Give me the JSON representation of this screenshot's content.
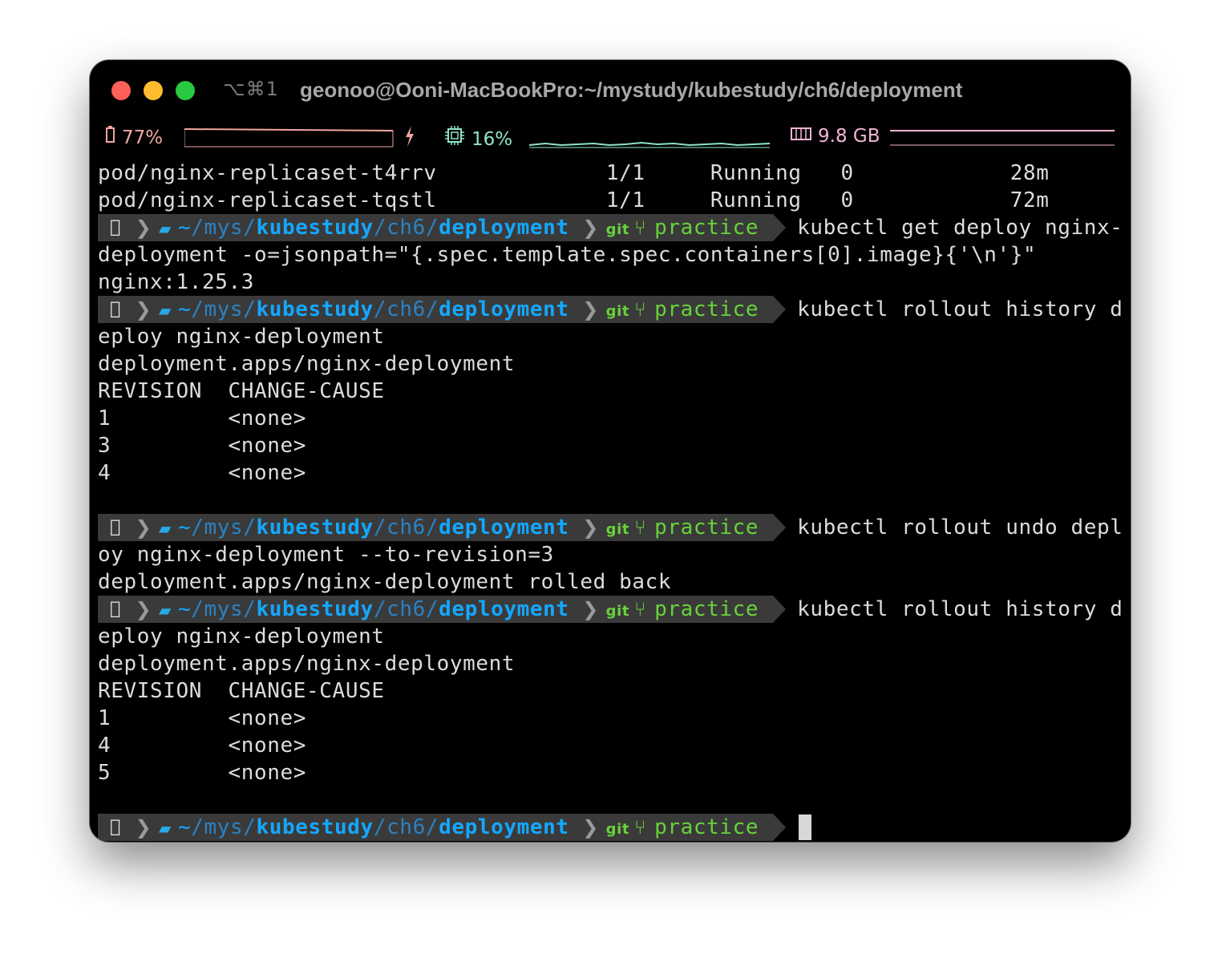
{
  "window": {
    "shortcut": "⌥⌘1",
    "title": "geonoo@Ooni-MacBookPro:~/mystudy/kubestudy/ch6/deployment"
  },
  "status": {
    "battery": "77%",
    "cpu": "16%",
    "memory": "9.8 GB"
  },
  "prompt": {
    "tilde": "~",
    "seg1": "/mys/",
    "seg2": "kubestudy",
    "seg3": "/ch6/",
    "seg4": "deployment",
    "git": "git",
    "branch": "practice"
  },
  "lines": {
    "l1": "pod/nginx-replicaset-t4rrv             1/1     Running   0            28m",
    "l2": "pod/nginx-replicaset-tqstl             1/1     Running   0            72m",
    "c1": "kubectl get deploy nginx-",
    "l4": "deployment -o=jsonpath=\"{.spec.template.spec.containers[0].image}{'\\n'}\"",
    "l5": "nginx:1.25.3",
    "c2": "kubectl rollout history d",
    "l7": "eploy nginx-deployment",
    "l8": "deployment.apps/nginx-deployment",
    "l9": "REVISION  CHANGE-CAUSE",
    "l10": "1         <none>",
    "l11": "3         <none>",
    "l12": "4         <none>",
    "c3": "kubectl rollout undo depl",
    "l15": "oy nginx-deployment --to-revision=3",
    "l16": "deployment.apps/nginx-deployment rolled back",
    "c4": "kubectl rollout history d",
    "l18": "eploy nginx-deployment",
    "l19": "deployment.apps/nginx-deployment",
    "l20": "REVISION  CHANGE-CAUSE",
    "l21": "1         <none>",
    "l22": "4         <none>",
    "l23": "5         <none>"
  },
  "colors": {
    "battery": "#f1a6a0",
    "cpu": "#8ee3c8",
    "memory": "#f5b5d6",
    "branch": "#68d23a",
    "path": "#14a7ff"
  },
  "icons": [
    "battery-icon",
    "bolt-icon",
    "cpu-icon",
    "memory-icon",
    "apple-icon",
    "folder-icon",
    "git-branch-icon"
  ]
}
